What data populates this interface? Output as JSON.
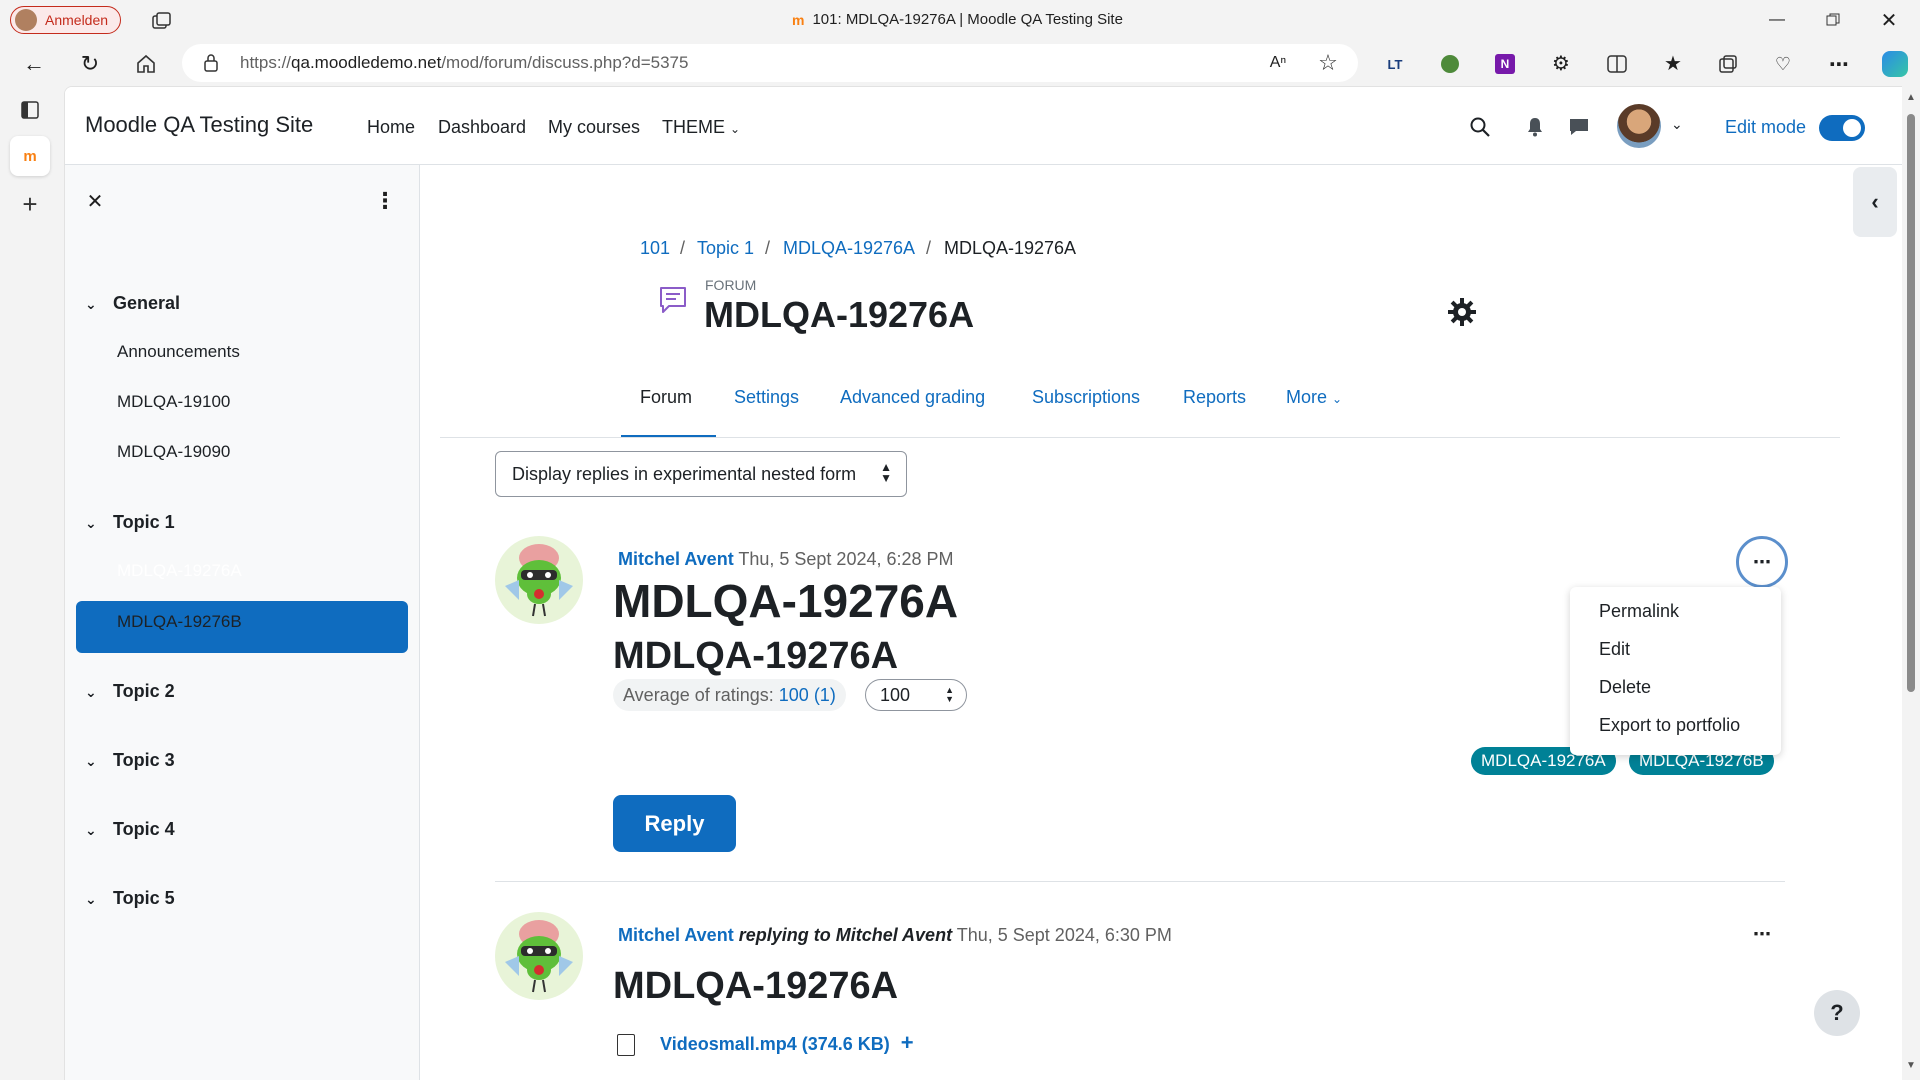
{
  "browser": {
    "profile_label": "Anmelden",
    "tab_title": "101: MDLQA-19276A | Moodle QA Testing Site",
    "url": "https://qa.moodledemo.net/mod/forum/discuss.php?d=5375",
    "url_prefix": "https://",
    "url_host": "qa.moodledemo.net",
    "url_path": "/mod/forum/discuss.php?d=5375"
  },
  "navbar": {
    "site_name": "Moodle QA Testing Site",
    "links": [
      "Home",
      "Dashboard",
      "My courses",
      "THEME"
    ],
    "edit_mode_label": "Edit mode",
    "edit_mode_on": true
  },
  "course_index": {
    "sections": [
      {
        "title": "General",
        "items": [
          "Announcements",
          "MDLQA-19100",
          "MDLQA-19090"
        ]
      },
      {
        "title": "Topic 1",
        "items": [
          "MDLQA-19276A",
          "MDLQA-19276B"
        ]
      },
      {
        "title": "Topic 2",
        "items": []
      },
      {
        "title": "Topic 3",
        "items": []
      },
      {
        "title": "Topic 4",
        "items": []
      },
      {
        "title": "Topic 5",
        "items": []
      }
    ],
    "active_item": "MDLQA-19276A"
  },
  "breadcrumb": [
    "101",
    "Topic 1",
    "MDLQA-19276A",
    "MDLQA-19276A"
  ],
  "page": {
    "module_label": "FORUM",
    "title": "MDLQA-19276A"
  },
  "tabs": [
    "Forum",
    "Settings",
    "Advanced grading",
    "Subscriptions",
    "Reports",
    "More"
  ],
  "display_mode": "Display replies in experimental nested form",
  "posts": [
    {
      "author": "Mitchel Avent",
      "date": "Thu, 5 Sept 2024, 6:28 PM",
      "subject": "MDLQA-19276A",
      "body": "MDLQA-19276A",
      "rating_label": "Average of ratings:",
      "rating_value": "100 (1)",
      "rating_select": "100",
      "tags": [
        "MDLQA-19276A",
        "MDLQA-19276B"
      ],
      "reply_label": "Reply"
    },
    {
      "author": "Mitchel Avent",
      "replying_to": "replying to Mitchel Avent",
      "date": "Thu, 5 Sept 2024, 6:30 PM",
      "subject": "MDLQA-19276A",
      "attachment": "Videosmall.mp4 (374.6 KB)"
    }
  ],
  "post_menu": [
    "Permalink",
    "Edit",
    "Delete",
    "Export to portfolio"
  ],
  "help_label": "?"
}
